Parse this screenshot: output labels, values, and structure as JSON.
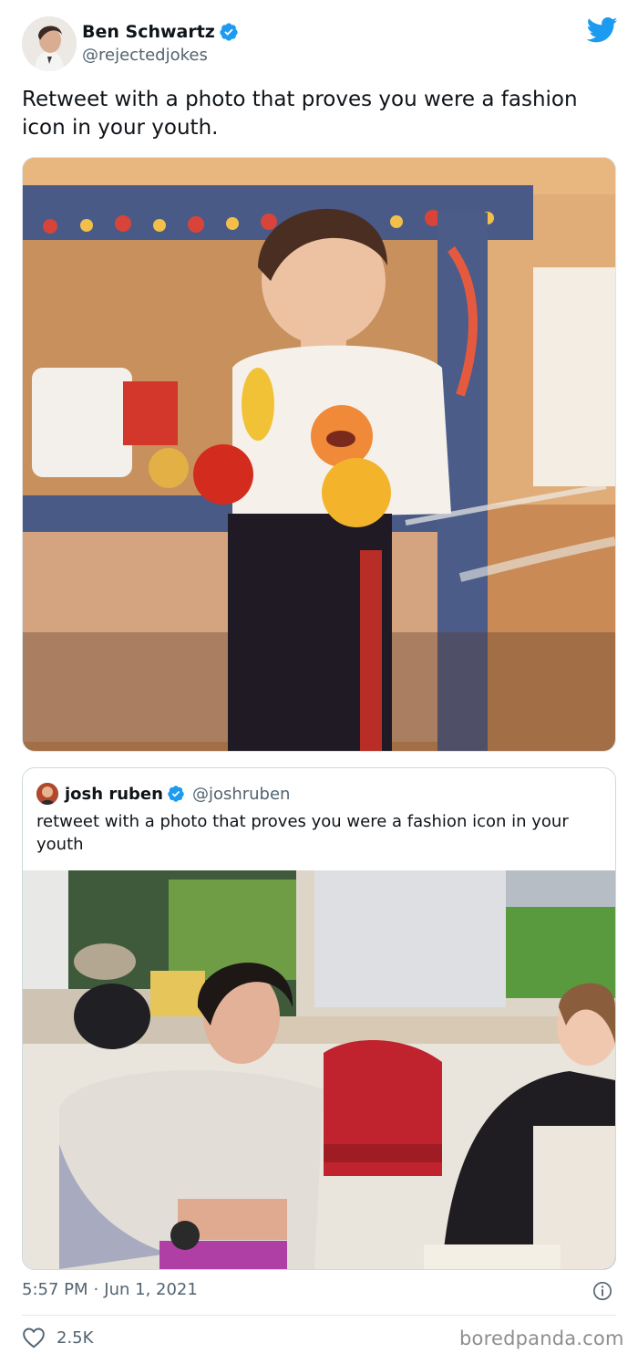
{
  "author": {
    "name": "Ben Schwartz",
    "handle": "@rejectedjokes",
    "verified": true,
    "avatar_icon": "profile-photo"
  },
  "tweet": {
    "text": "Retweet with a photo that proves you were a fashion icon in your youth.",
    "photo_icon": "childhood-photo-toddler-with-balls"
  },
  "quoted_tweet": {
    "author_name": "josh ruben",
    "author_handle": "@joshruben",
    "verified": true,
    "text": "retweet with a photo that proves you were a fashion icon in your youth",
    "photo_icon": "classroom-photo-teen-in-uniform"
  },
  "meta": {
    "time": "5:57 PM",
    "separator": "·",
    "date": "Jun 1, 2021"
  },
  "engagement": {
    "likes": "2.5K"
  },
  "watermark": "boredpanda.com",
  "colors": {
    "twitter_blue": "#1d9bf0",
    "text_primary": "#0f1419",
    "text_secondary": "#536471"
  }
}
